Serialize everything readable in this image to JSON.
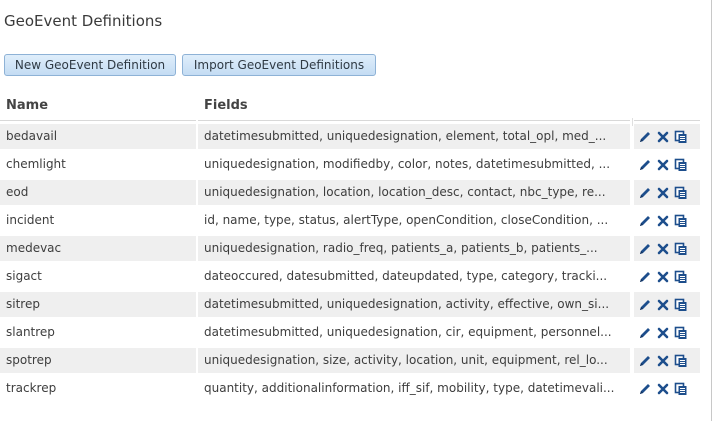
{
  "page": {
    "title": "GeoEvent Definitions"
  },
  "toolbar": {
    "new_label": "New GeoEvent Definition",
    "import_label": "Import GeoEvent Definitions"
  },
  "table": {
    "columns": {
      "name": "Name",
      "fields": "Fields"
    },
    "rows": [
      {
        "name": "bedavail",
        "fields": "datetimesubmitted, uniquedesignation, element, total_opl, med_..."
      },
      {
        "name": "chemlight",
        "fields": "uniquedesignation, modifiedby, color, notes, datetimesubmitted, ..."
      },
      {
        "name": "eod",
        "fields": "uniquedesignation, location, location_desc, contact, nbc_type, re..."
      },
      {
        "name": "incident",
        "fields": "id, name, type, status, alertType, openCondition, closeCondition, ..."
      },
      {
        "name": "medevac",
        "fields": "uniquedesignation, radio_freq, patients_a, patients_b, patients_..."
      },
      {
        "name": "sigact",
        "fields": "dateoccured, datesubmitted, dateupdated, type, category, tracki..."
      },
      {
        "name": "sitrep",
        "fields": "datetimesubmitted, uniquedesignation, activity, effective, own_si..."
      },
      {
        "name": "slantrep",
        "fields": "datetimesubmitted, uniquedesignation, cir, equipment, personnel..."
      },
      {
        "name": "spotrep",
        "fields": "uniquedesignation, size, activity, location, unit, equipment, rel_lo..."
      },
      {
        "name": "trackrep",
        "fields": "quantity, additionalinformation, iff_sif, mobility, type, datetimevali..."
      }
    ]
  },
  "icons": {
    "edit": "pencil-icon",
    "delete": "x-icon",
    "copy": "copy-icon"
  },
  "colors": {
    "icon_blue": "#1d4e8c",
    "row_alt": "#efefef",
    "button_border": "#8eb2d6"
  }
}
